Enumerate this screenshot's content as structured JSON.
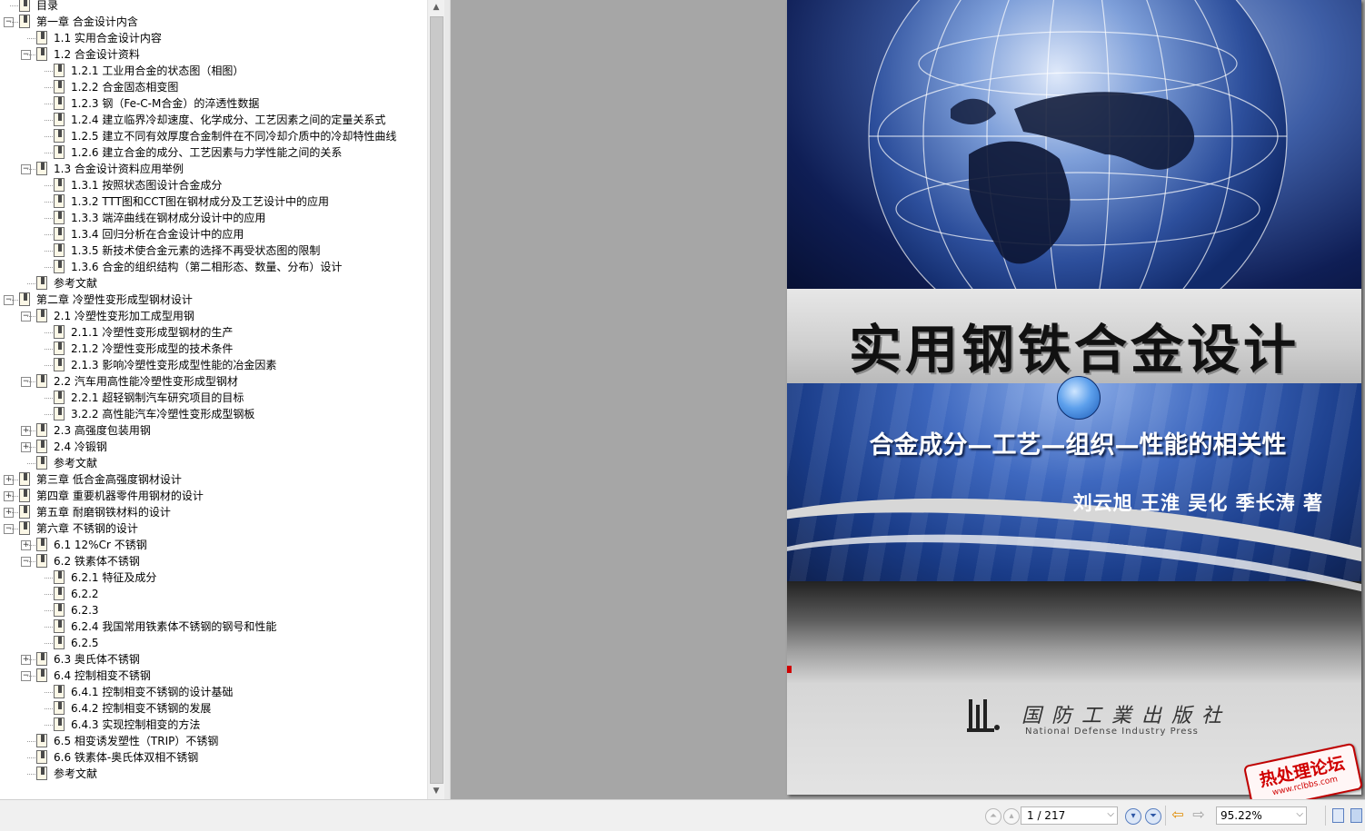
{
  "bookmarks": [
    {
      "label": "目录",
      "expander": ""
    },
    {
      "label": "第一章 合金设计内含",
      "expander": "−"
    },
    {
      "label": "1.1 实用合金设计内容",
      "expander": ""
    },
    {
      "label": "1.2 合金设计资料",
      "expander": "−"
    },
    {
      "label": "1.2.1 工业用合金的状态图（相图）",
      "expander": ""
    },
    {
      "label": "1.2.2 合金固态相变图",
      "expander": ""
    },
    {
      "label": "1.2.3 钢（Fe-C-M合金）的淬透性数据",
      "expander": ""
    },
    {
      "label": "1.2.4 建立临界冷却速度、化学成分、工艺因素之间的定量关系式",
      "expander": ""
    },
    {
      "label": "1.2.5 建立不同有效厚度合金制件在不同冷却介质中的冷却特性曲线",
      "expander": ""
    },
    {
      "label": "1.2.6 建立合金的成分、工艺因素与力学性能之间的关系",
      "expander": ""
    },
    {
      "label": "1.3 合金设计资料应用举例",
      "expander": "−"
    },
    {
      "label": "1.3.1 按照状态图设计合金成分",
      "expander": ""
    },
    {
      "label": "1.3.2 TTT图和CCT图在钢材成分及工艺设计中的应用",
      "expander": ""
    },
    {
      "label": "1.3.3 端淬曲线在钢材成分设计中的应用",
      "expander": ""
    },
    {
      "label": "1.3.4 回归分析在合金设计中的应用",
      "expander": ""
    },
    {
      "label": "1.3.5 新技术使合金元素的选择不再受状态图的限制",
      "expander": ""
    },
    {
      "label": "1.3.6 合金的组织结构（第二相形态、数量、分布）设计",
      "expander": ""
    },
    {
      "label": "参考文献",
      "expander": ""
    },
    {
      "label": "第二章 冷塑性变形成型钢材设计",
      "expander": "−"
    },
    {
      "label": "2.1 冷塑性变形加工成型用钢",
      "expander": "−"
    },
    {
      "label": "2.1.1 冷塑性变形成型钢材的生产",
      "expander": ""
    },
    {
      "label": "2.1.2 冷塑性变形成型的技术条件",
      "expander": ""
    },
    {
      "label": "2.1.3 影响冷塑性变形成型性能的冶金因素",
      "expander": ""
    },
    {
      "label": "2.2 汽车用高性能冷塑性变形成型钢材",
      "expander": "−"
    },
    {
      "label": "2.2.1 超轻钢制汽车研究项目的目标",
      "expander": ""
    },
    {
      "label": "3.2.2 高性能汽车冷塑性变形成型钢板",
      "expander": ""
    },
    {
      "label": "2.3 高强度包装用钢",
      "expander": "+"
    },
    {
      "label": "2.4 冷锻钢",
      "expander": "+"
    },
    {
      "label": "参考文献",
      "expander": ""
    },
    {
      "label": "第三章 低合金高强度钢材设计",
      "expander": "+"
    },
    {
      "label": "第四章 重要机器零件用钢材的设计",
      "expander": "+"
    },
    {
      "label": "第五章 耐磨钢铁材料的设计",
      "expander": "+"
    },
    {
      "label": "第六章 不锈钢的设计",
      "expander": "−"
    },
    {
      "label": "6.1 12%Cr 不锈钢",
      "expander": "+"
    },
    {
      "label": "6.2 铁素体不锈钢",
      "expander": "−"
    },
    {
      "label": "6.2.1 特征及成分",
      "expander": ""
    },
    {
      "label": "6.2.2",
      "expander": ""
    },
    {
      "label": "6.2.3",
      "expander": ""
    },
    {
      "label": "6.2.4 我国常用铁素体不锈钢的钢号和性能",
      "expander": ""
    },
    {
      "label": "6.2.5",
      "expander": ""
    },
    {
      "label": "6.3 奥氏体不锈钢",
      "expander": "+"
    },
    {
      "label": "6.4 控制相变不锈钢",
      "expander": "−"
    },
    {
      "label": "6.4.1 控制相变不锈钢的设计基础",
      "expander": ""
    },
    {
      "label": "6.4.2 控制相变不锈钢的发展",
      "expander": ""
    },
    {
      "label": "6.4.3 实现控制相变的方法",
      "expander": ""
    },
    {
      "label": "6.5 相变诱发塑性（TRIP）不锈钢",
      "expander": ""
    },
    {
      "label": "6.6 铁素体-奥氏体双相不锈钢",
      "expander": ""
    },
    {
      "label": "参考文献",
      "expander": ""
    }
  ],
  "cover": {
    "title": "实用钢铁合金设计",
    "subtitle": "合金成分—工艺—组织—性能的相关性",
    "authors": "刘云旭  王淮  吴化  季长涛  著",
    "press_cn": "国 防 工 業 出 版 社",
    "press_en": "National Defense Industry Press"
  },
  "watermark": {
    "text": "热处理论坛",
    "url": "www.rclbbs.com"
  },
  "statusbar": {
    "page_value": "1 / 217",
    "zoom_value": "95.22%",
    "dropdown_glyph": "⌵"
  },
  "icons": {
    "first_page": "first-page-icon",
    "prev_page": "previous-page-icon",
    "next_page": "next-page-icon",
    "last_page": "last-page-icon",
    "back": "back-arrow-icon",
    "forward": "forward-arrow-icon",
    "single_page": "single-page-view-icon",
    "continuous": "continuous-view-icon",
    "bookmark": "bookmark-icon"
  },
  "colors": {
    "accent_blue": "#2f58a6",
    "watermark_red": "#d00000",
    "back_arrow": "#e08a00"
  }
}
